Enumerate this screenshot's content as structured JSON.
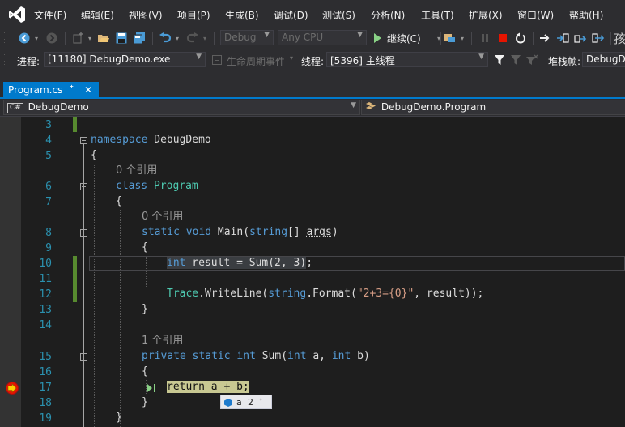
{
  "menu": [
    "文件(F)",
    "编辑(E)",
    "视图(V)",
    "项目(P)",
    "生成(B)",
    "调试(D)",
    "测试(S)",
    "分析(N)",
    "工具(T)",
    "扩展(X)",
    "窗口(W)",
    "帮助(H)"
  ],
  "toolbar": {
    "config_value": "Debug",
    "platform_value": "Any CPU",
    "continue_label": "继续(C)",
    "overflow_glyph": "孩"
  },
  "debug": {
    "process_label": "进程:",
    "process_value": "[11180] DebugDemo.exe",
    "lifecycle_label": "生命周期事件",
    "thread_label": "线程:",
    "thread_value": "[5396] 主线程",
    "stack_label": "堆栈帧:",
    "stack_value": "DebugD"
  },
  "tab": {
    "title": "Program.cs",
    "pin_glyph": "ᐩ",
    "close_glyph": "✕",
    "accent": "#007acc"
  },
  "nav": {
    "project_tag": "C#",
    "project": "DebugDemo",
    "class": "DebugDemo.Program"
  },
  "editor": {
    "line_numbers": [
      "3",
      "4",
      "5",
      "6",
      "7",
      "8",
      "9",
      "10",
      "11",
      "12",
      "13",
      "14",
      "15",
      "16",
      "17",
      "18",
      "19"
    ],
    "refs": {
      "program": "0 个引用",
      "main": "0 个引用",
      "sum": "1 个引用"
    },
    "code": {
      "ns_kw": "namespace",
      "ns_name": " DebugDemo",
      "brace_open": "{",
      "brace_close": "}",
      "class_kw": "class",
      "class_name": "Program",
      "main_static": "static",
      "main_void": "void",
      "main_name": " Main(",
      "main_string": "string",
      "main_brackets": "[] ",
      "main_args": "args",
      "main_close": ")",
      "l10_int": "int",
      "l10_rest_a": " result = Sum(2, 3)",
      "l10_semi": ";",
      "l12_trace": "Trace",
      "l12_dot": ".WriteLine(",
      "l12_string": "string",
      "l12_format": ".Format(",
      "l12_lit": "\"2+3={0}\"",
      "l12_end": ", result));",
      "sum_private": "private",
      "sum_static": "static",
      "sum_int": "int",
      "sum_name": " Sum(",
      "sum_int_a": "int",
      "sum_a": " a, ",
      "sum_int_b": "int",
      "sum_b": " b)",
      "ret": "return a + b;"
    },
    "datatip": {
      "name": "a",
      "value": "2",
      "pin_glyph": "ᐩ"
    }
  },
  "colors": {
    "keyword": "#569cd6",
    "type": "#4ec9b0",
    "string": "#d69d85",
    "linenumber": "#2b91af",
    "breakpoint": "#e51400",
    "current_line": "#c8c892"
  }
}
